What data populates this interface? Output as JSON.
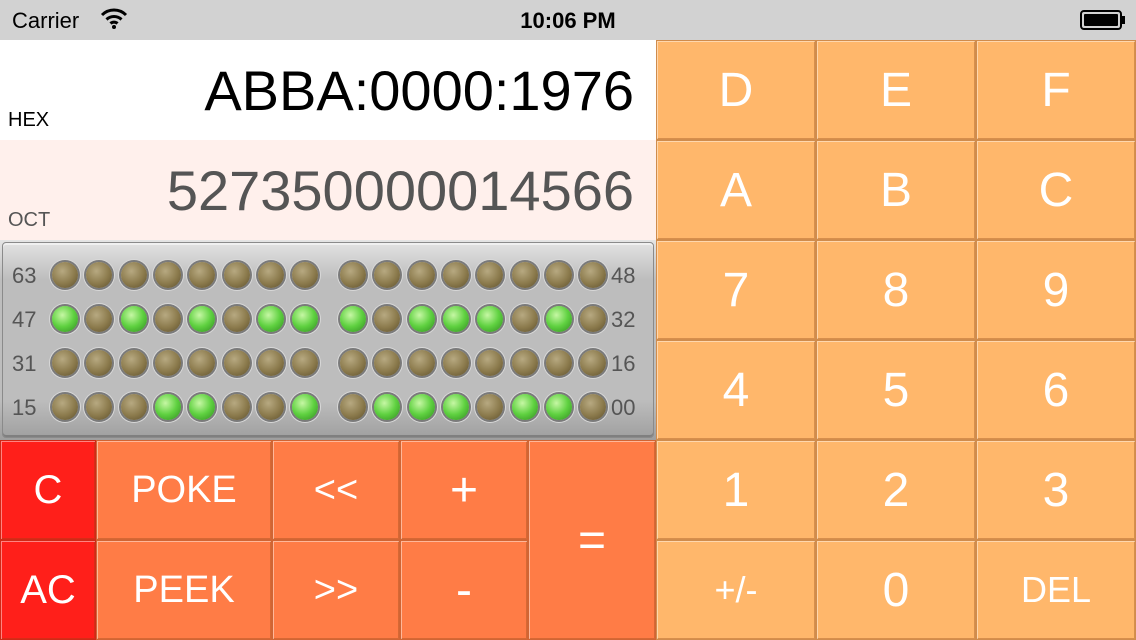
{
  "status_bar": {
    "carrier": "Carrier",
    "time": "10:06 PM"
  },
  "display": {
    "hex": {
      "label": "HEX",
      "value": "ABBA:0000:1976"
    },
    "oct": {
      "label": "OCT",
      "value": "527350000014566"
    }
  },
  "bit_panel": {
    "rows": [
      {
        "left_label": "63",
        "right_label": "48",
        "bits": [
          0,
          0,
          0,
          0,
          0,
          0,
          0,
          0,
          0,
          0,
          0,
          0,
          0,
          0,
          0,
          0
        ]
      },
      {
        "left_label": "47",
        "right_label": "32",
        "bits": [
          1,
          0,
          1,
          0,
          1,
          0,
          1,
          1,
          1,
          0,
          1,
          1,
          1,
          0,
          1,
          0
        ]
      },
      {
        "left_label": "31",
        "right_label": "16",
        "bits": [
          0,
          0,
          0,
          0,
          0,
          0,
          0,
          0,
          0,
          0,
          0,
          0,
          0,
          0,
          0,
          0
        ]
      },
      {
        "left_label": "15",
        "right_label": "00",
        "bits": [
          0,
          0,
          0,
          1,
          1,
          0,
          0,
          1,
          0,
          1,
          1,
          1,
          0,
          1,
          1,
          0
        ]
      }
    ]
  },
  "buttons": {
    "c": "C",
    "ac": "AC",
    "poke": "POKE",
    "peek": "PEEK",
    "shift_left": "<<",
    "shift_right": ">>",
    "plus": "+",
    "minus": "-",
    "equals": "=",
    "keypad": [
      [
        "D",
        "E",
        "F"
      ],
      [
        "A",
        "B",
        "C"
      ],
      [
        "7",
        "8",
        "9"
      ],
      [
        "4",
        "5",
        "6"
      ],
      [
        "1",
        "2",
        "3"
      ],
      [
        "+/-",
        "0",
        "DEL"
      ]
    ]
  },
  "colors": {
    "operator": "#ff7c46",
    "clear": "#ff1f1a",
    "digit": "#ffb76b",
    "led_on": "#5fd140",
    "led_off": "#8b7a4c"
  }
}
